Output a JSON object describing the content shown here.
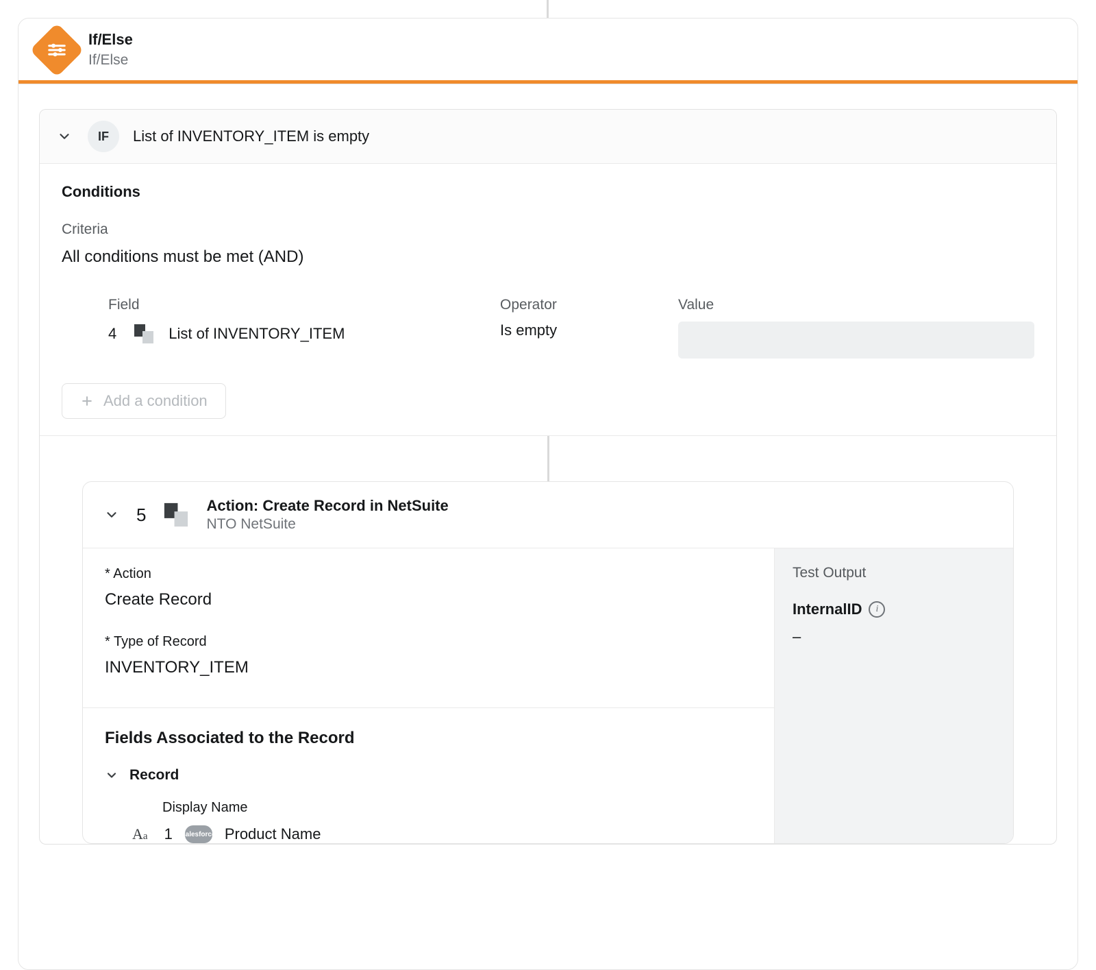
{
  "header": {
    "title": "If/Else",
    "subtitle": "If/Else"
  },
  "branch": {
    "badge": "IF",
    "title": "List of INVENTORY_ITEM is empty"
  },
  "conditions": {
    "heading": "Conditions",
    "criteria_label": "Criteria",
    "criteria_text": "All conditions must be met (AND)",
    "columns": {
      "field": "Field",
      "operator": "Operator",
      "value": "Value"
    },
    "row": {
      "step": "4",
      "field_text": "List of INVENTORY_ITEM",
      "operator": "Is empty",
      "value": ""
    },
    "add_label": "Add a condition"
  },
  "action": {
    "step": "5",
    "title": "Action: Create Record in NetSuite",
    "subtitle": "NTO NetSuite",
    "form": {
      "action_label": "* Action",
      "action_value": "Create Record",
      "type_label": "* Type of Record",
      "type_value": "INVENTORY_ITEM"
    },
    "fields": {
      "title": "Fields Associated to the Record",
      "record_label": "Record",
      "display_name_label": "Display Name",
      "display_name_step": "1",
      "display_name_value": "Product Name",
      "source_badge": "salesforce"
    },
    "test": {
      "label": "Test Output",
      "field": "InternalID",
      "value": "–"
    }
  }
}
